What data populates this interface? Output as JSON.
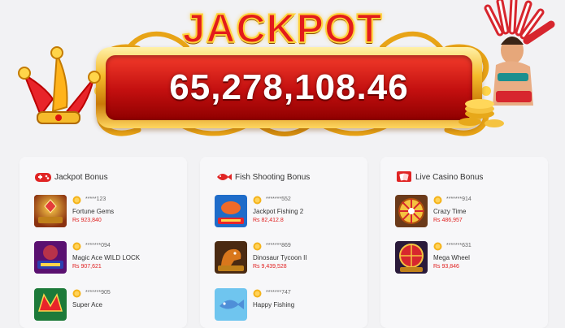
{
  "jackpot": {
    "title": "JACKPOT",
    "amount": "65,278,108.46"
  },
  "sections": [
    {
      "title": "Jackpot Bonus",
      "icon": "gamepad-icon",
      "items": [
        {
          "user": "*****123",
          "game": "Fortune Gems",
          "amount": "Rs 923,840"
        },
        {
          "user": "*******094",
          "game": "Magic Ace WILD LOCK",
          "amount": "Rs 907,621"
        },
        {
          "user": "*******905",
          "game": "Super Ace",
          "amount": ""
        }
      ]
    },
    {
      "title": "Fish Shooting Bonus",
      "icon": "fish-icon",
      "items": [
        {
          "user": "*******552",
          "game": "Jackpot Fishing 2",
          "amount": "Rs 82,412.8"
        },
        {
          "user": "*******869",
          "game": "Dinosaur Tycoon II",
          "amount": "Rs 9,439,528"
        },
        {
          "user": "*******747",
          "game": "Happy Fishing",
          "amount": ""
        }
      ]
    },
    {
      "title": "Live Casino Bonus",
      "icon": "live-casino-icon",
      "items": [
        {
          "user": "*******914",
          "game": "Crazy Time",
          "amount": "Rs 486,957"
        },
        {
          "user": "*******631",
          "game": "Mega Wheel",
          "amount": "Rs 93,846"
        }
      ]
    }
  ],
  "colors": {
    "accent_red": "#e02020",
    "gold": "#f5bb2b",
    "page_bg": "#f2f2f4",
    "card_bg": "#f7f7f9"
  }
}
